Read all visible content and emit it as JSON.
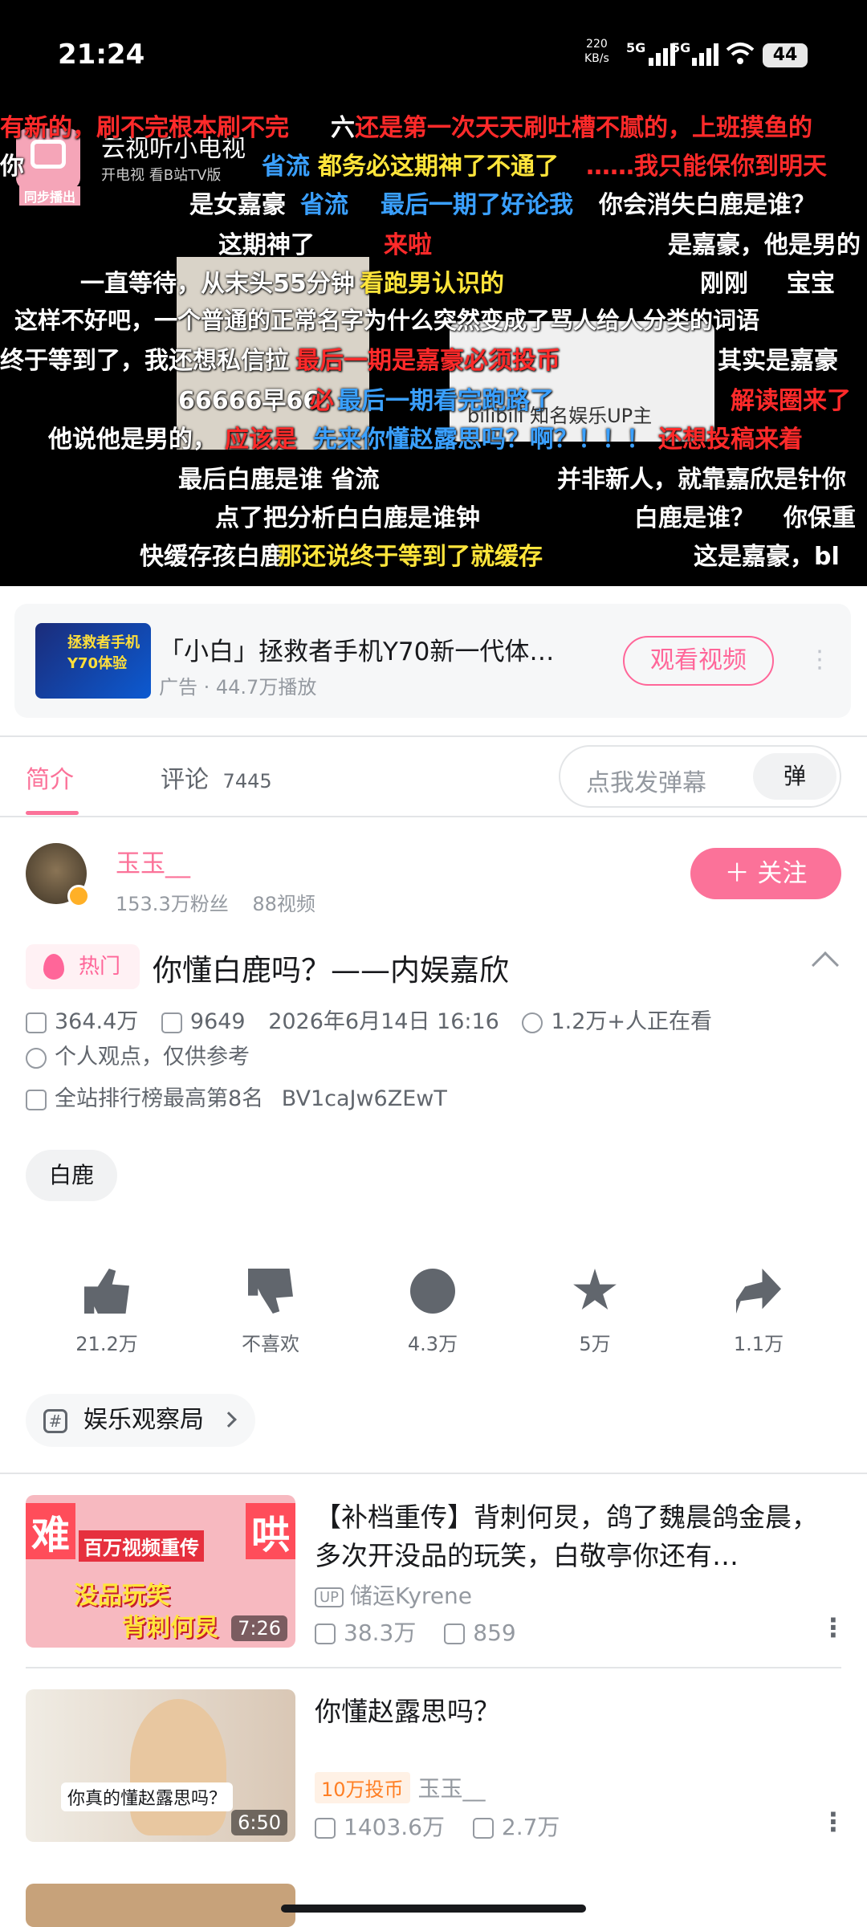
{
  "status_bar": {
    "time": "21:24",
    "net_rate": "220\nKB/s",
    "sig1": "5G",
    "sig2": "5G",
    "battery": "44"
  },
  "player": {
    "channel_name": "云视听小电视",
    "channel_sub": "开电视 看B站TV版",
    "sync_label": "同步播出",
    "danmaku": [
      {
        "text": "有新的，刷不完根本刷不完",
        "color": "red"
      },
      {
        "text": "六",
        "color": "white"
      },
      {
        "text": "还是第一次天天刷吐槽不腻的，上班摸鱼的",
        "color": "red"
      },
      {
        "text": "你",
        "color": "white"
      },
      {
        "text": "省流",
        "color": "blue"
      },
      {
        "text": "都务必这期神了不通了",
        "color": "yellow"
      },
      {
        "text": "……我只能保你到明天",
        "color": "red"
      },
      {
        "text": "是女嘉豪",
        "color": "white"
      },
      {
        "text": "省流",
        "color": "blue"
      },
      {
        "text": "最后一期了好论我",
        "color": "blue"
      },
      {
        "text": "你会消失白鹿是谁？",
        "color": "white"
      },
      {
        "text": "这期神了",
        "color": "white"
      },
      {
        "text": "来啦",
        "color": "red"
      },
      {
        "text": "是嘉豪，他是男的",
        "color": "white"
      },
      {
        "text": "一直等待，从末头55分钟",
        "color": "white"
      },
      {
        "text": "看跑男认识的",
        "color": "yellow"
      },
      {
        "text": "刚刚",
        "color": "white"
      },
      {
        "text": "宝宝",
        "color": "white"
      },
      {
        "text": "这样不好吧，一个普通的正常名字为什么突然变成了骂人给人分类的词语",
        "color": "white"
      },
      {
        "text": "终于等到了，我还想私信拉",
        "color": "white"
      },
      {
        "text": "最后一期是嘉豪必须投币",
        "color": "red"
      },
      {
        "text": "其实是嘉豪",
        "color": "white"
      },
      {
        "text": "66666早66",
        "color": "white"
      },
      {
        "text": "必",
        "color": "red"
      },
      {
        "text": "最后一期看完跑路了",
        "color": "blue"
      },
      {
        "text": "解读圈来了",
        "color": "red"
      },
      {
        "text": "他说他是男的，",
        "color": "white"
      },
      {
        "text": "应该是",
        "color": "red"
      },
      {
        "text": "先来你懂赵露思吗？啊？！！！",
        "color": "blue"
      },
      {
        "text": "还想投稿来着",
        "color": "red"
      },
      {
        "text": "最后白鹿是谁 省流",
        "color": "white"
      },
      {
        "text": "并非新人，就靠嘉欣是针你",
        "color": "white"
      },
      {
        "text": "点了把分析白白鹿是谁钟",
        "color": "white"
      },
      {
        "text": "白鹿是谁？",
        "color": "white"
      },
      {
        "text": "你保重",
        "color": "white"
      },
      {
        "text": "快缓存孩白鹿",
        "color": "white"
      },
      {
        "text": "那还说终于等到了就缓存",
        "color": "yellow"
      },
      {
        "text": "这是嘉豪，bl",
        "color": "white"
      },
      {
        "text": "bilibili 知名娱乐UP主",
        "color": "white"
      }
    ]
  },
  "ad": {
    "thumb_text": "拯救者手机\nY70体验",
    "title": "「小白」拯救者手机Y70新一代体…",
    "meta": "广告 · 44.7万播放",
    "button": "观看视频",
    "more": "⋮"
  },
  "tabs": {
    "intro": "简介",
    "comments": "评论",
    "comments_count": "7445"
  },
  "danmu_input": {
    "placeholder": "点我发弹幕",
    "button": "弹"
  },
  "uploader": {
    "name": "玉玉__",
    "fans": "153.3万粉丝",
    "videos": "88视频",
    "follow": "＋ 关注"
  },
  "video": {
    "hot_label": "热门",
    "title": "你懂白鹿吗？——内娱嘉欣",
    "views": "364.4万",
    "danmaku_count": "9649",
    "date": "2026年6月14日 16:16",
    "watching": "1.2万+人正在看",
    "notice": "个人观点，仅供参考",
    "rank": "全站排行榜最高第8名",
    "bvid": "BV1caJw6ZEwT",
    "tag": "白鹿"
  },
  "actions": {
    "like": "21.2万",
    "dislike": "不喜欢",
    "coin": "4.3万",
    "favorite": "5万",
    "share": "1.1万"
  },
  "topic": "娱乐观察局",
  "recommendations": [
    {
      "title": "【补档重传】背刺何炅，鸽了魏晨鸽金晨，多次开没品的玩笑，白敬亭你还有…",
      "thumb_text_1": "难",
      "thumb_text_2": "百万视频重传",
      "thumb_text_3": "哄",
      "thumb_text_4": "没品玩笑",
      "thumb_text_5": "背刺何炅",
      "duration": "7:26",
      "badge": "UP",
      "uploader": "储运Kyrene",
      "views": "38.3万",
      "danmaku": "859"
    },
    {
      "title": "你懂赵露思吗？",
      "thumb_text_1": "你真的懂赵露思吗？",
      "duration": "6:50",
      "badge": "10万投币",
      "uploader": "玉玉__",
      "views": "1403.6万",
      "danmaku": "2.7万"
    }
  ],
  "colors": {
    "accent": "#fb7299",
    "text": "#18191c",
    "muted": "#9499a0"
  }
}
